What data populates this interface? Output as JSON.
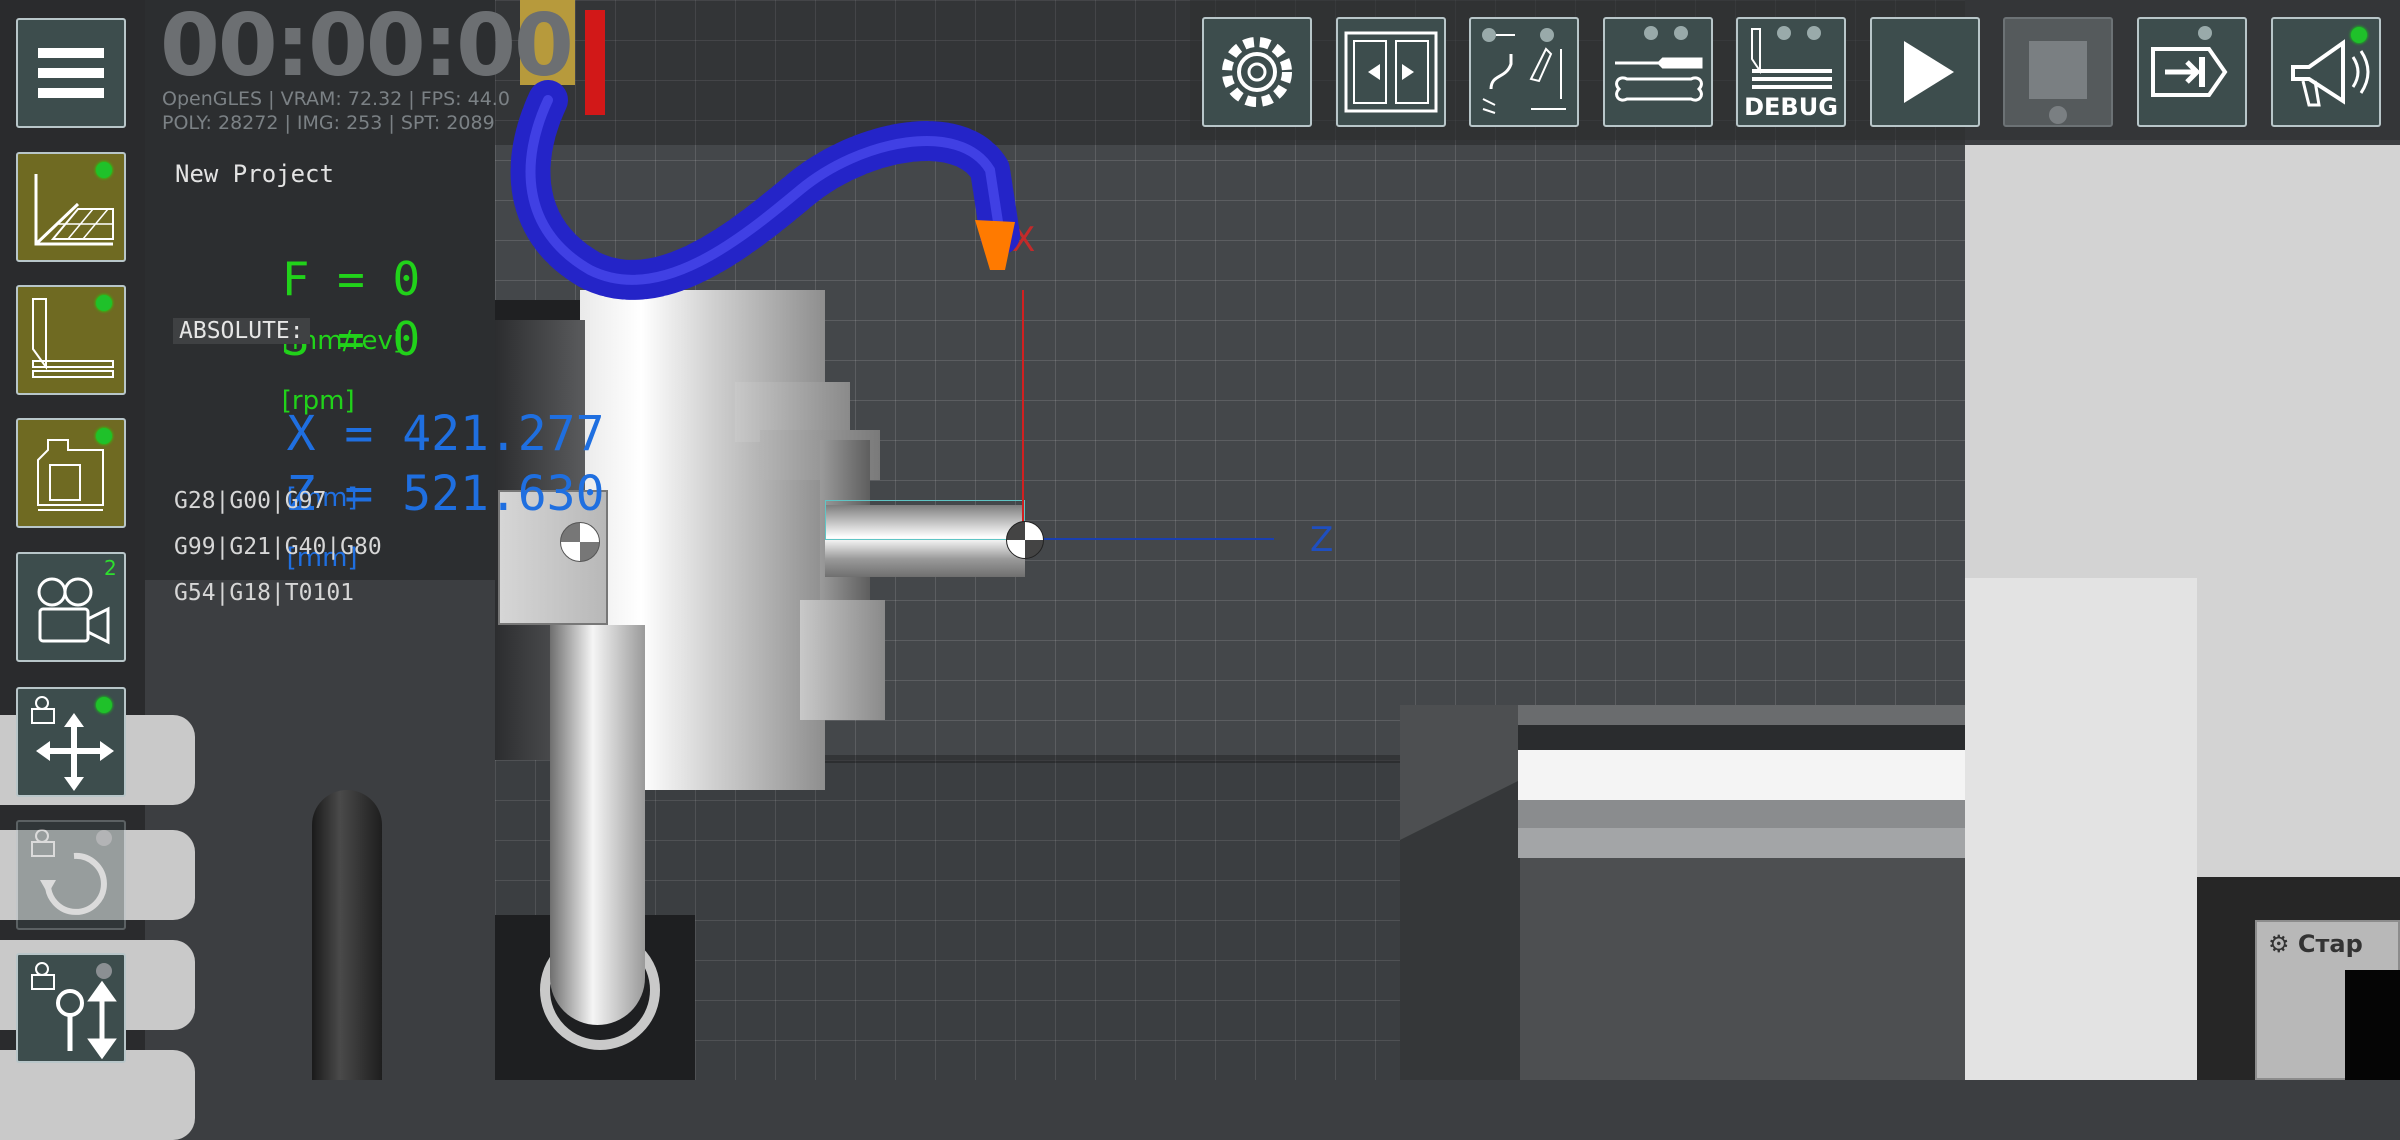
{
  "timer": "00:00:00",
  "stats": {
    "line1": "OpenGLES | VRAM: 72.32 | FPS: 44.0",
    "line2": "POLY: 28272 | IMG: 253 | SPT: 2089"
  },
  "project_name": "New Project",
  "feed": {
    "text": "F = 0",
    "unit": "[mm/rev]"
  },
  "spindle": {
    "text": "S = 0",
    "unit": "[rpm]"
  },
  "coord_mode": "ABSOLUTE:",
  "coords": {
    "x": {
      "text": "X = 421.277",
      "unit": "[mm]"
    },
    "z": {
      "text": "Z = 521.630",
      "unit": "[mm]"
    }
  },
  "gcodes": {
    "line1": "G28|G00|G97",
    "line2": "G99|G21|G40|G80",
    "line3": "G54|G18|T0101"
  },
  "axes": {
    "x_label": "X",
    "z_label": "Z"
  },
  "left_toolbar": [
    {
      "id": "menu",
      "icon": "menu-icon"
    },
    {
      "id": "workpiece-coordinates",
      "icon": "coordinate-grid-icon",
      "status": "on"
    },
    {
      "id": "tool-setup",
      "icon": "tool-holder-icon",
      "status": "on"
    },
    {
      "id": "machine-view",
      "icon": "machine-icon",
      "status": "on"
    },
    {
      "id": "camera",
      "icon": "camera-icon",
      "badge": "2"
    },
    {
      "id": "camera-pan",
      "icon": "pan-arrows-icon",
      "status": "on"
    },
    {
      "id": "camera-rotate",
      "icon": "rotate-icon",
      "status": "off",
      "enabled": false
    },
    {
      "id": "camera-zoom",
      "icon": "zoom-icon",
      "status": "off"
    }
  ],
  "top_toolbar": [
    {
      "id": "settings",
      "icon": "gear-icon"
    },
    {
      "id": "doors",
      "icon": "doors-icon"
    },
    {
      "id": "tool-library",
      "icon": "tools-measure-icon"
    },
    {
      "id": "maintenance",
      "icon": "wrench-screwdriver-icon"
    },
    {
      "id": "debug",
      "icon": "debug-icon",
      "label": "DEBUG"
    },
    {
      "id": "play",
      "icon": "play-icon"
    },
    {
      "id": "stop",
      "icon": "stop-icon",
      "enabled": false
    },
    {
      "id": "exit",
      "icon": "exit-icon"
    },
    {
      "id": "announcement",
      "icon": "megaphone-icon",
      "status": "on"
    }
  ],
  "corner_panel_label": "Стар",
  "colors": {
    "accent_green": "#21d21a",
    "accent_blue": "#1f6fe0",
    "button_bg": "#3d4d4d",
    "button_bg_active": "#6f6a22",
    "button_border": "#b8c6c9",
    "coolant_hose": "#2424c8",
    "nozzle": "#ff7a00"
  }
}
